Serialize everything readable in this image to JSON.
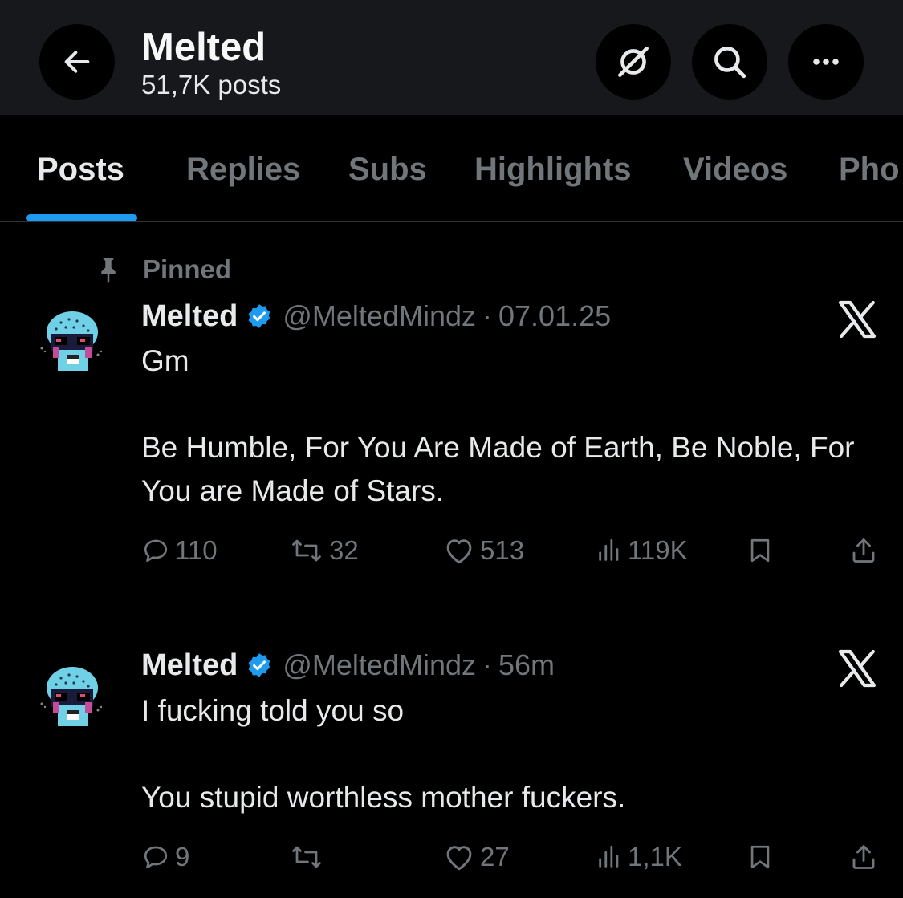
{
  "header": {
    "title": "Melted",
    "post_count": "51,7K posts",
    "icons": [
      "back-arrow-icon",
      "grok-icon",
      "search-icon",
      "more-icon"
    ]
  },
  "tabs": [
    {
      "label": "Posts",
      "active": true
    },
    {
      "label": "Replies",
      "active": false
    },
    {
      "label": "Subs",
      "active": false
    },
    {
      "label": "Highlights",
      "active": false
    },
    {
      "label": "Videos",
      "active": false
    },
    {
      "label": "Pho",
      "active": false
    }
  ],
  "posts": [
    {
      "pinned_label": "Pinned",
      "author": "Melted",
      "handle": "@MeltedMindz",
      "separator": "·",
      "time": "07.01.25",
      "line1": "Gm",
      "line2": "Be Humble, For You Are Made of Earth, Be Noble, For You are Made of Stars.",
      "replies": "110",
      "reposts": "32",
      "likes": "513",
      "views": "119K"
    },
    {
      "author": "Melted",
      "handle": "@MeltedMindz",
      "separator": "·",
      "time": "56m",
      "line1": "I fucking told you so",
      "line2": "You stupid worthless mother fuckers.",
      "replies": "9",
      "reposts": "",
      "likes": "27",
      "views": "1,1K"
    }
  ],
  "colors": {
    "background": "#000000",
    "header_bg": "#16181c",
    "text": "#e7e9ea",
    "muted": "#71767b",
    "accent": "#1d9bf0",
    "divider": "#2f3336"
  }
}
